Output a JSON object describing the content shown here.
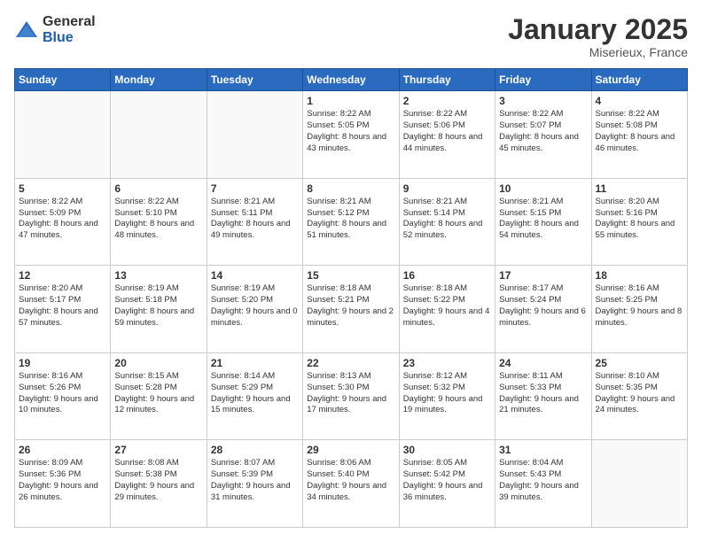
{
  "logo": {
    "general": "General",
    "blue": "Blue"
  },
  "header": {
    "month": "January 2025",
    "location": "Miserieux, France"
  },
  "days_of_week": [
    "Sunday",
    "Monday",
    "Tuesday",
    "Wednesday",
    "Thursday",
    "Friday",
    "Saturday"
  ],
  "weeks": [
    [
      {
        "day": "",
        "info": ""
      },
      {
        "day": "",
        "info": ""
      },
      {
        "day": "",
        "info": ""
      },
      {
        "day": "1",
        "info": "Sunrise: 8:22 AM\nSunset: 5:05 PM\nDaylight: 8 hours\nand 43 minutes."
      },
      {
        "day": "2",
        "info": "Sunrise: 8:22 AM\nSunset: 5:06 PM\nDaylight: 8 hours\nand 44 minutes."
      },
      {
        "day": "3",
        "info": "Sunrise: 8:22 AM\nSunset: 5:07 PM\nDaylight: 8 hours\nand 45 minutes."
      },
      {
        "day": "4",
        "info": "Sunrise: 8:22 AM\nSunset: 5:08 PM\nDaylight: 8 hours\nand 46 minutes."
      }
    ],
    [
      {
        "day": "5",
        "info": "Sunrise: 8:22 AM\nSunset: 5:09 PM\nDaylight: 8 hours\nand 47 minutes."
      },
      {
        "day": "6",
        "info": "Sunrise: 8:22 AM\nSunset: 5:10 PM\nDaylight: 8 hours\nand 48 minutes."
      },
      {
        "day": "7",
        "info": "Sunrise: 8:21 AM\nSunset: 5:11 PM\nDaylight: 8 hours\nand 49 minutes."
      },
      {
        "day": "8",
        "info": "Sunrise: 8:21 AM\nSunset: 5:12 PM\nDaylight: 8 hours\nand 51 minutes."
      },
      {
        "day": "9",
        "info": "Sunrise: 8:21 AM\nSunset: 5:14 PM\nDaylight: 8 hours\nand 52 minutes."
      },
      {
        "day": "10",
        "info": "Sunrise: 8:21 AM\nSunset: 5:15 PM\nDaylight: 8 hours\nand 54 minutes."
      },
      {
        "day": "11",
        "info": "Sunrise: 8:20 AM\nSunset: 5:16 PM\nDaylight: 8 hours\nand 55 minutes."
      }
    ],
    [
      {
        "day": "12",
        "info": "Sunrise: 8:20 AM\nSunset: 5:17 PM\nDaylight: 8 hours\nand 57 minutes."
      },
      {
        "day": "13",
        "info": "Sunrise: 8:19 AM\nSunset: 5:18 PM\nDaylight: 8 hours\nand 59 minutes."
      },
      {
        "day": "14",
        "info": "Sunrise: 8:19 AM\nSunset: 5:20 PM\nDaylight: 9 hours\nand 0 minutes."
      },
      {
        "day": "15",
        "info": "Sunrise: 8:18 AM\nSunset: 5:21 PM\nDaylight: 9 hours\nand 2 minutes."
      },
      {
        "day": "16",
        "info": "Sunrise: 8:18 AM\nSunset: 5:22 PM\nDaylight: 9 hours\nand 4 minutes."
      },
      {
        "day": "17",
        "info": "Sunrise: 8:17 AM\nSunset: 5:24 PM\nDaylight: 9 hours\nand 6 minutes."
      },
      {
        "day": "18",
        "info": "Sunrise: 8:16 AM\nSunset: 5:25 PM\nDaylight: 9 hours\nand 8 minutes."
      }
    ],
    [
      {
        "day": "19",
        "info": "Sunrise: 8:16 AM\nSunset: 5:26 PM\nDaylight: 9 hours\nand 10 minutes."
      },
      {
        "day": "20",
        "info": "Sunrise: 8:15 AM\nSunset: 5:28 PM\nDaylight: 9 hours\nand 12 minutes."
      },
      {
        "day": "21",
        "info": "Sunrise: 8:14 AM\nSunset: 5:29 PM\nDaylight: 9 hours\nand 15 minutes."
      },
      {
        "day": "22",
        "info": "Sunrise: 8:13 AM\nSunset: 5:30 PM\nDaylight: 9 hours\nand 17 minutes."
      },
      {
        "day": "23",
        "info": "Sunrise: 8:12 AM\nSunset: 5:32 PM\nDaylight: 9 hours\nand 19 minutes."
      },
      {
        "day": "24",
        "info": "Sunrise: 8:11 AM\nSunset: 5:33 PM\nDaylight: 9 hours\nand 21 minutes."
      },
      {
        "day": "25",
        "info": "Sunrise: 8:10 AM\nSunset: 5:35 PM\nDaylight: 9 hours\nand 24 minutes."
      }
    ],
    [
      {
        "day": "26",
        "info": "Sunrise: 8:09 AM\nSunset: 5:36 PM\nDaylight: 9 hours\nand 26 minutes."
      },
      {
        "day": "27",
        "info": "Sunrise: 8:08 AM\nSunset: 5:38 PM\nDaylight: 9 hours\nand 29 minutes."
      },
      {
        "day": "28",
        "info": "Sunrise: 8:07 AM\nSunset: 5:39 PM\nDaylight: 9 hours\nand 31 minutes."
      },
      {
        "day": "29",
        "info": "Sunrise: 8:06 AM\nSunset: 5:40 PM\nDaylight: 9 hours\nand 34 minutes."
      },
      {
        "day": "30",
        "info": "Sunrise: 8:05 AM\nSunset: 5:42 PM\nDaylight: 9 hours\nand 36 minutes."
      },
      {
        "day": "31",
        "info": "Sunrise: 8:04 AM\nSunset: 5:43 PM\nDaylight: 9 hours\nand 39 minutes."
      },
      {
        "day": "",
        "info": ""
      }
    ]
  ]
}
